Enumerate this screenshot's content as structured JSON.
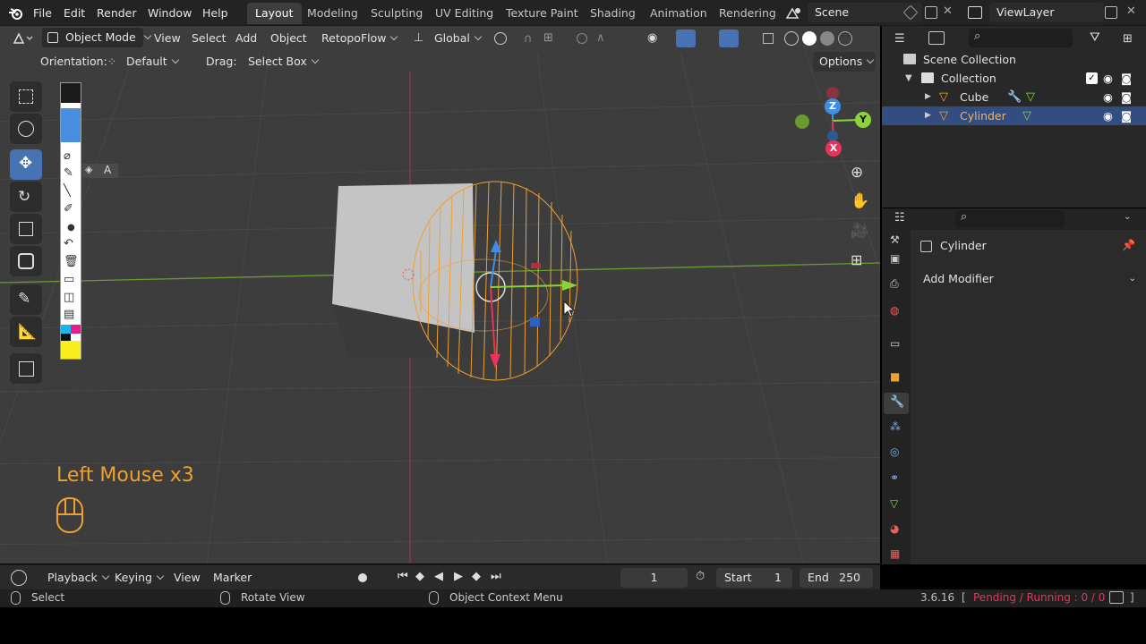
{
  "topbar": {
    "menus": [
      "File",
      "Edit",
      "Render",
      "Window",
      "Help"
    ],
    "workspaces": [
      "Layout",
      "Modeling",
      "Sculpting",
      "UV Editing",
      "Texture Paint",
      "Shading",
      "Animation",
      "Rendering"
    ],
    "active_workspace": "Layout",
    "scene": "Scene",
    "view_layer": "ViewLayer"
  },
  "viewport_header": {
    "mode": "Object Mode",
    "menus": [
      "View",
      "Select",
      "Add",
      "Object",
      "RetopoFlow"
    ],
    "transform_orientation": "Global",
    "orientation_label": "Orientation:",
    "orientation_value": "Default",
    "drag_label": "Drag:",
    "drag_value": "Select Box",
    "options": "Options"
  },
  "gizmo": {
    "z": "Z",
    "y": "Y",
    "x": "X"
  },
  "screencast": {
    "text": "Left Mouse x3"
  },
  "annotate_tool": {
    "letter": "A"
  },
  "outliner": {
    "root": "Scene Collection",
    "collection": "Collection",
    "objects": [
      "Cube",
      "Cylinder"
    ],
    "selected": "Cylinder"
  },
  "properties": {
    "object_name": "Cylinder",
    "add_modifier": "Add Modifier"
  },
  "timeline": {
    "menus": [
      "Playback",
      "Keying",
      "View",
      "Marker"
    ],
    "current_frame": "1",
    "start_label": "Start",
    "start": "1",
    "end_label": "End",
    "end": "250"
  },
  "statusbar": {
    "select": "Select",
    "rotate": "Rotate View",
    "context": "Object Context Menu",
    "version": "3.6.16",
    "jobs": "Pending / Running : 0 / 0"
  },
  "colors": {
    "accent": "#4772b3",
    "selection": "#f0a030",
    "axis_x": "#e8345a",
    "axis_y": "#8cd33a",
    "axis_z": "#3d8ee6",
    "viewport_bg": "#3d3d3d"
  }
}
